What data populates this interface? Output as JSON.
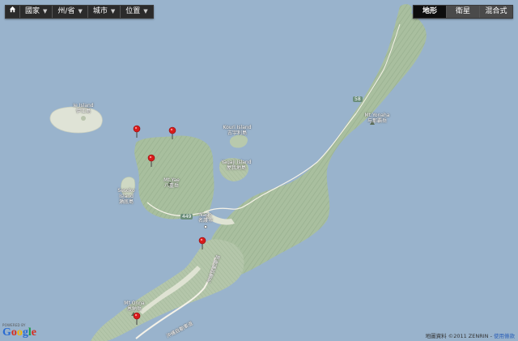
{
  "controls": {
    "nav": [
      {
        "label": "國家"
      },
      {
        "label": "州/省"
      },
      {
        "label": "城市"
      },
      {
        "label": "位置"
      }
    ],
    "map_types": [
      {
        "label": "地形",
        "active": true
      },
      {
        "label": "衛星",
        "active": false
      },
      {
        "label": "混合式",
        "active": false
      }
    ]
  },
  "places": {
    "ie_island": {
      "en": "Ie Island",
      "zh": "伊江島"
    },
    "kouri_island": {
      "en": "Kouri Island",
      "zh": "古宇利島"
    },
    "yagaji_island": {
      "en": "Yagaji Island",
      "zh": "屋我地島"
    },
    "sesoko_island": {
      "en": "Sesoko",
      "en2": "Island",
      "zh": "瀬底島"
    },
    "mt_yae": {
      "en": "Mt.Yae",
      "zh": "八重岳"
    },
    "nago": {
      "en": "Nago",
      "zh": "名護市"
    },
    "mt_yonaha": {
      "en": "Mt.Yonaha",
      "zh": "与那覇岳"
    },
    "mt_onna": {
      "en": "Mt.Onna",
      "zh": "恩納岳"
    }
  },
  "roads": {
    "route58_north": "58",
    "route449": "449",
    "expressway_a": "沖縄自動車道",
    "expressway_b": "沖縄自動車道"
  },
  "logo": {
    "powered": "POWERED BY",
    "word": "Google"
  },
  "attribution": {
    "text": "地圖資料 ©2011 ZENRIN - ",
    "link": "使用條款"
  },
  "colors": {
    "sea": "#99b3cc",
    "land": "#dfe4d2",
    "forest": "#a9bfa0",
    "pin": "#d81b1b"
  }
}
